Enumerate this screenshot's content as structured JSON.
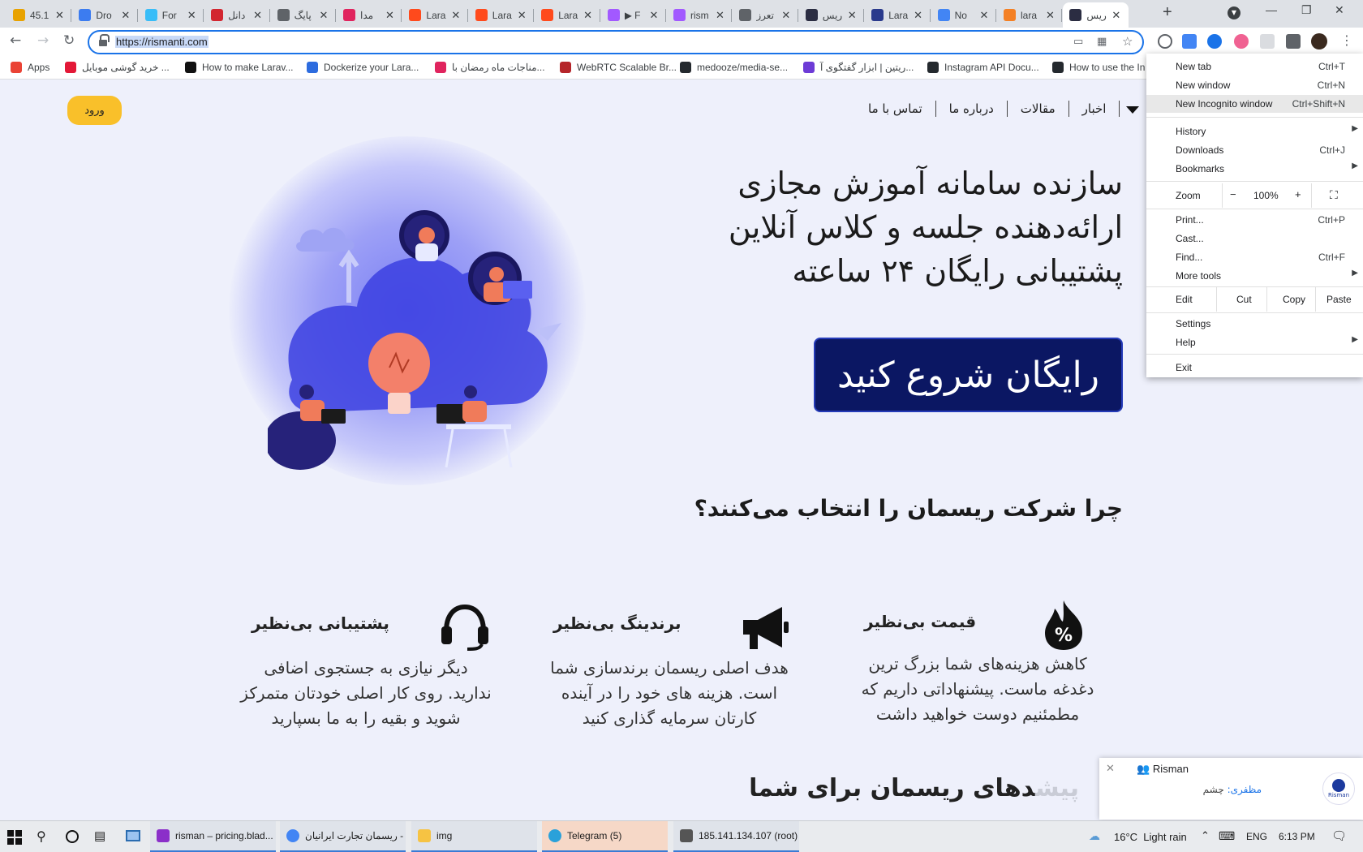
{
  "browser": {
    "tabs": [
      {
        "title": "45.1",
        "color": "#e8a200"
      },
      {
        "title": "Dro",
        "color": "#3c7cf0"
      },
      {
        "title": "For",
        "color": "#38bdf8"
      },
      {
        "title": "دانل",
        "color": "#d22630"
      },
      {
        "title": "پایگ",
        "color": "#5f6368"
      },
      {
        "title": "مدا",
        "color": "#e0245e"
      },
      {
        "title": "Lara",
        "color": "#ff4a1c"
      },
      {
        "title": "Lara",
        "color": "#ff4a1c"
      },
      {
        "title": "Lara",
        "color": "#ff4a1c"
      },
      {
        "title": "▶ F",
        "color": "#a259ff"
      },
      {
        "title": "rism",
        "color": "#a259ff"
      },
      {
        "title": "تعرز",
        "color": "#5f6368"
      },
      {
        "title": "ریس",
        "color": "#2b2d42"
      },
      {
        "title": "Lara",
        "color": "#2a3a8c"
      },
      {
        "title": "No",
        "color": "#4285f4"
      },
      {
        "title": "lara",
        "color": "#f48024"
      },
      {
        "title": "ریس",
        "color": "#2b2d42"
      }
    ],
    "new_tab_symbol": "+",
    "url": "https://rismanti.com",
    "bookmarks": [
      {
        "label": "Apps",
        "color": "#ea4335"
      },
      {
        "label": "خرید گوشی موبایل ...",
        "color": "#e31837"
      },
      {
        "label": "How to make Larav...",
        "color": "#111111"
      },
      {
        "label": "Dockerize your Lara...",
        "color": "#2d6cdf"
      },
      {
        "label": "مناجات ماه رمضان با...",
        "color": "#e0245e"
      },
      {
        "label": "WebRTC Scalable Br...",
        "color": "#b5252a"
      },
      {
        "label": "medooze/media-se...",
        "color": "#24292e"
      },
      {
        "label": "ریتین | ابزار گفتگوی آ...",
        "color": "#6d3bd6"
      },
      {
        "label": "Instagram API Docu...",
        "color": "#24292e"
      },
      {
        "label": "How to use the In",
        "color": "#24292e"
      }
    ]
  },
  "site": {
    "login_label": "ورود",
    "nav": [
      "اخبار",
      "مقالات",
      "درباره ما",
      "تماس با ما"
    ],
    "hero_lines": [
      "سازنده سامانه آموزش مجازی",
      "ارائه‌دهنده جلسه و کلاس آنلاین",
      "پشتیبانی رایگان ۲۴ ساعته"
    ],
    "cta_label": "رایگان شروع کنید",
    "why_title": "چرا شرکت ریسمان را انتخاب می‌کنند؟",
    "features": [
      {
        "title": "قیمت بی‌نظیر",
        "icon": "fire-percent-icon",
        "lines": [
          "کاهش هزینه‌های شما بزرگ ترین",
          "دغدغه ماست. پیشنهاداتی داریم که",
          "مطمئنیم دوست خواهید داشت"
        ]
      },
      {
        "title": "برندینگ بی‌نظیر",
        "icon": "megaphone-icon",
        "lines": [
          "هدف اصلی ریسمان برندسازی شما",
          "است. هزینه های خود را در آینده",
          "کارتان سرمایه گذاری کنید"
        ]
      },
      {
        "title": "پشتیبانی بی‌نظیر",
        "icon": "headset-icon",
        "lines": [
          "دیگر نیازی به جستجوی اضافی",
          "ندارید. روی کار اصلی خودتان متمرکز",
          "شوید و بقیه را به ما بسپارید"
        ]
      }
    ],
    "bottom_heading": "دهای ریسمان برای شما",
    "bottom_heading_faded": "پیش"
  },
  "menu": {
    "items": [
      {
        "label": "New tab",
        "shortcut": "Ctrl+T"
      },
      {
        "label": "New window",
        "shortcut": "Ctrl+N"
      },
      {
        "label": "New Incognito window",
        "shortcut": "Ctrl+Shift+N",
        "highlighted": true
      },
      {
        "label": "History",
        "submenu": true
      },
      {
        "label": "Downloads",
        "shortcut": "Ctrl+J"
      },
      {
        "label": "Bookmarks",
        "submenu": true
      },
      {
        "label": "Print...",
        "shortcut": "Ctrl+P"
      },
      {
        "label": "Cast..."
      },
      {
        "label": "Find...",
        "shortcut": "Ctrl+F"
      },
      {
        "label": "More tools",
        "submenu": true
      },
      {
        "label": "Settings"
      },
      {
        "label": "Help",
        "submenu": true
      },
      {
        "label": "Exit"
      }
    ],
    "zoom_label": "Zoom",
    "zoom_minus": "−",
    "zoom_value": "100%",
    "zoom_plus": "+",
    "edit_label": "Edit",
    "cut_label": "Cut",
    "copy_label": "Copy",
    "paste_label": "Paste"
  },
  "chat": {
    "title": "Risman",
    "sender": "مظفری:",
    "message": "چشم",
    "logo_text": "Risman"
  },
  "taskbar": {
    "apps": [
      {
        "label": "risman – pricing.blad...",
        "color": "#8b2fc9"
      },
      {
        "label": "ریسمان تجارت ایرانیان - ...",
        "color": "#4285f4"
      },
      {
        "label": "img",
        "color": "#f6c343"
      },
      {
        "label": "Telegram (5)",
        "color": "#2aa1da"
      },
      {
        "label": "185.141.134.107 (root)",
        "color": "#555555"
      }
    ],
    "weather": "16°C  Light rain",
    "language": "ENG",
    "time": "6:13 PM"
  }
}
